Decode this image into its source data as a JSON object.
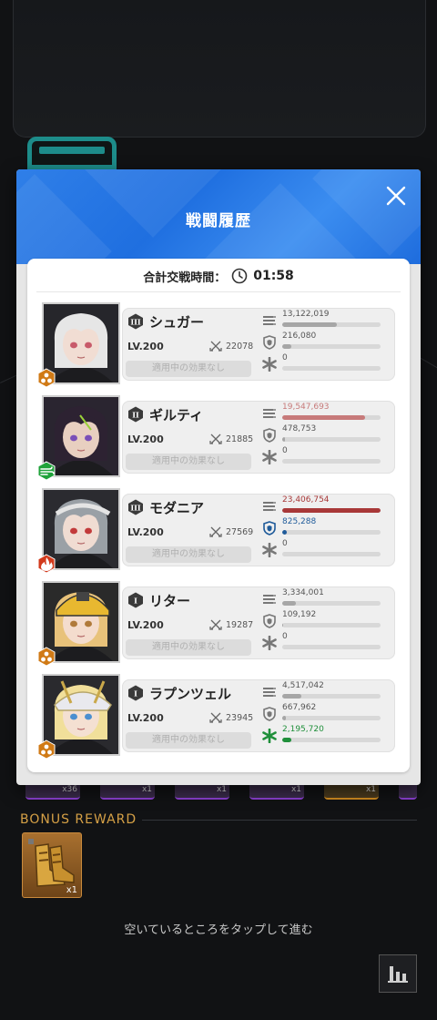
{
  "modal": {
    "title": "戦闘履歴",
    "battle_time_label": "合計交戦時間：",
    "battle_time_value": "01:58"
  },
  "characters": [
    {
      "burst": "III",
      "name": "シュガー",
      "level": "LV.200",
      "power": "22078",
      "effect": "適用中の効果なし",
      "element": "iron-icon",
      "damage": "13,122,019",
      "damage_fraction": 0.56,
      "damage_color": "#a6a6a6",
      "shield": "216,080",
      "shield_fraction": 0.09,
      "shield_color": "#a6a6a6",
      "heal": "0",
      "heal_fraction": 0,
      "heal_color": "#a6a6a6",
      "element_color": "#d07a16"
    },
    {
      "burst": "II",
      "name": "ギルティ",
      "level": "LV.200",
      "power": "21885",
      "effect": "適用中の効果なし",
      "element": "wind-icon",
      "damage": "19,547,693",
      "damage_fraction": 0.84,
      "damage_color": "#c77a7a",
      "shield": "478,753",
      "shield_fraction": 0.03,
      "shield_color": "#a6a6a6",
      "heal": "0",
      "heal_fraction": 0,
      "heal_color": "#a6a6a6",
      "element_color": "#1fa23a"
    },
    {
      "burst": "III",
      "name": "モダニア",
      "level": "LV.200",
      "power": "27569",
      "effect": "適用中の効果なし",
      "element": "fire-icon",
      "damage": "23,406,754",
      "damage_fraction": 1.0,
      "damage_color": "#a83838",
      "shield": "825,288",
      "shield_fraction": 0.05,
      "shield_color": "#1f5b9a",
      "heal": "0",
      "heal_fraction": 0,
      "heal_color": "#a6a6a6",
      "element_color": "#d23a1c"
    },
    {
      "burst": "I",
      "name": "リター",
      "level": "LV.200",
      "power": "19287",
      "effect": "適用中の効果なし",
      "element": "iron-icon",
      "damage": "3,334,001",
      "damage_fraction": 0.14,
      "damage_color": "#a6a6a6",
      "shield": "109,192",
      "shield_fraction": 0.01,
      "shield_color": "#a6a6a6",
      "heal": "0",
      "heal_fraction": 0,
      "heal_color": "#a6a6a6",
      "element_color": "#d07a16"
    },
    {
      "burst": "I",
      "name": "ラプンツェル",
      "level": "LV.200",
      "power": "23945",
      "effect": "適用中の効果なし",
      "element": "iron-icon",
      "damage": "4,517,042",
      "damage_fraction": 0.19,
      "damage_color": "#a6a6a6",
      "shield": "667,962",
      "shield_fraction": 0.04,
      "shield_color": "#a6a6a6",
      "heal": "2,195,720",
      "heal_fraction": 0.09,
      "heal_color": "#1f8f3a",
      "element_color": "#d07a16"
    }
  ],
  "loot_counts": [
    "x36",
    "x1",
    "x1",
    "x1",
    "x1"
  ],
  "bonus": {
    "title": "BONUS REWARD",
    "item_count": "x1"
  },
  "tap_hint": "空いているところをタップして進む"
}
